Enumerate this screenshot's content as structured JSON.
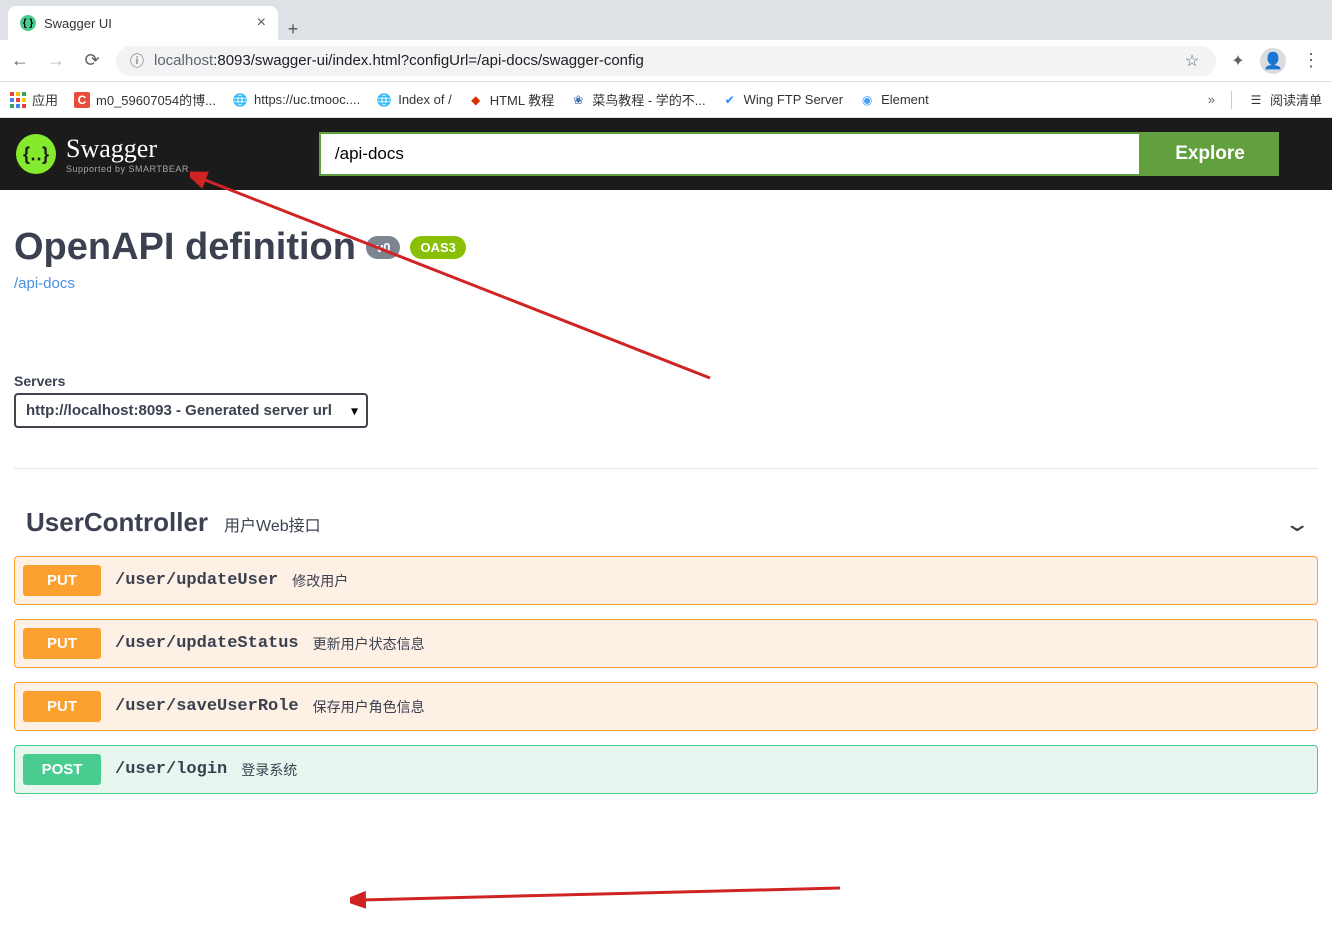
{
  "browser": {
    "tab": {
      "title": "Swagger UI"
    },
    "url": {
      "host": "localhost",
      "path": ":8093/swagger-ui/index.html?configUrl=/api-docs/swagger-config"
    },
    "bookmarks": {
      "apps": "应用",
      "items": [
        {
          "label": "m0_59607054的博..."
        },
        {
          "label": "https://uc.tmooc...."
        },
        {
          "label": "Index of /"
        },
        {
          "label": "HTML 教程"
        },
        {
          "label": "菜鸟教程 - 学的不..."
        },
        {
          "label": "Wing FTP Server"
        },
        {
          "label": "Element"
        }
      ],
      "more": "»",
      "reading_list": "阅读清单"
    }
  },
  "topbar": {
    "logo": "Swagger",
    "logo_sub": "Supported by SMARTBEAR",
    "input_value": "/api-docs",
    "explore_label": "Explore"
  },
  "info": {
    "title": "OpenAPI definition",
    "version": "v0",
    "oas": "OAS3",
    "doc_link": "/api-docs"
  },
  "servers": {
    "label": "Servers",
    "selected": "http://localhost:8093 - Generated server url"
  },
  "tag": {
    "name": "UserController",
    "desc": "用户Web接口"
  },
  "ops": [
    {
      "method": "PUT",
      "path": "/user/updateUser",
      "summary": "修改用户",
      "cls": "put"
    },
    {
      "method": "PUT",
      "path": "/user/updateStatus",
      "summary": "更新用户状态信息",
      "cls": "put"
    },
    {
      "method": "PUT",
      "path": "/user/saveUserRole",
      "summary": "保存用户角色信息",
      "cls": "put"
    },
    {
      "method": "POST",
      "path": "/user/login",
      "summary": "登录系统",
      "cls": "post"
    }
  ]
}
